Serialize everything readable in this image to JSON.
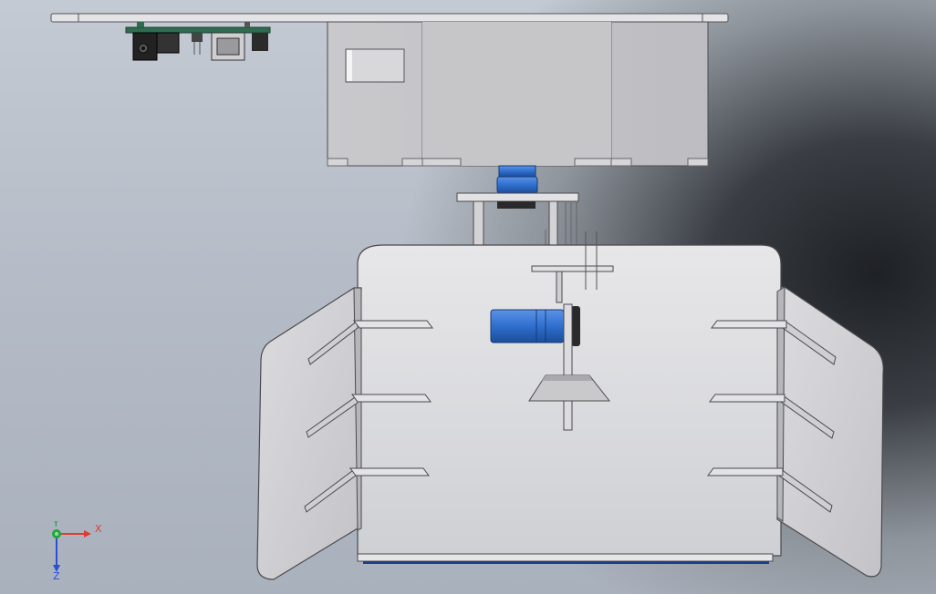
{
  "triad": {
    "x_label": "X",
    "y_label": "Y",
    "z_label": "Z"
  },
  "colors": {
    "part_face": "#d9d9dc",
    "part_edge": "#4a4a4e",
    "motor_blue": "#2f6fce",
    "pcb_green": "#2f6b4f",
    "axis_x": "#e23a2e",
    "axis_y": "#27a33a",
    "axis_z": "#2a4fd6"
  }
}
